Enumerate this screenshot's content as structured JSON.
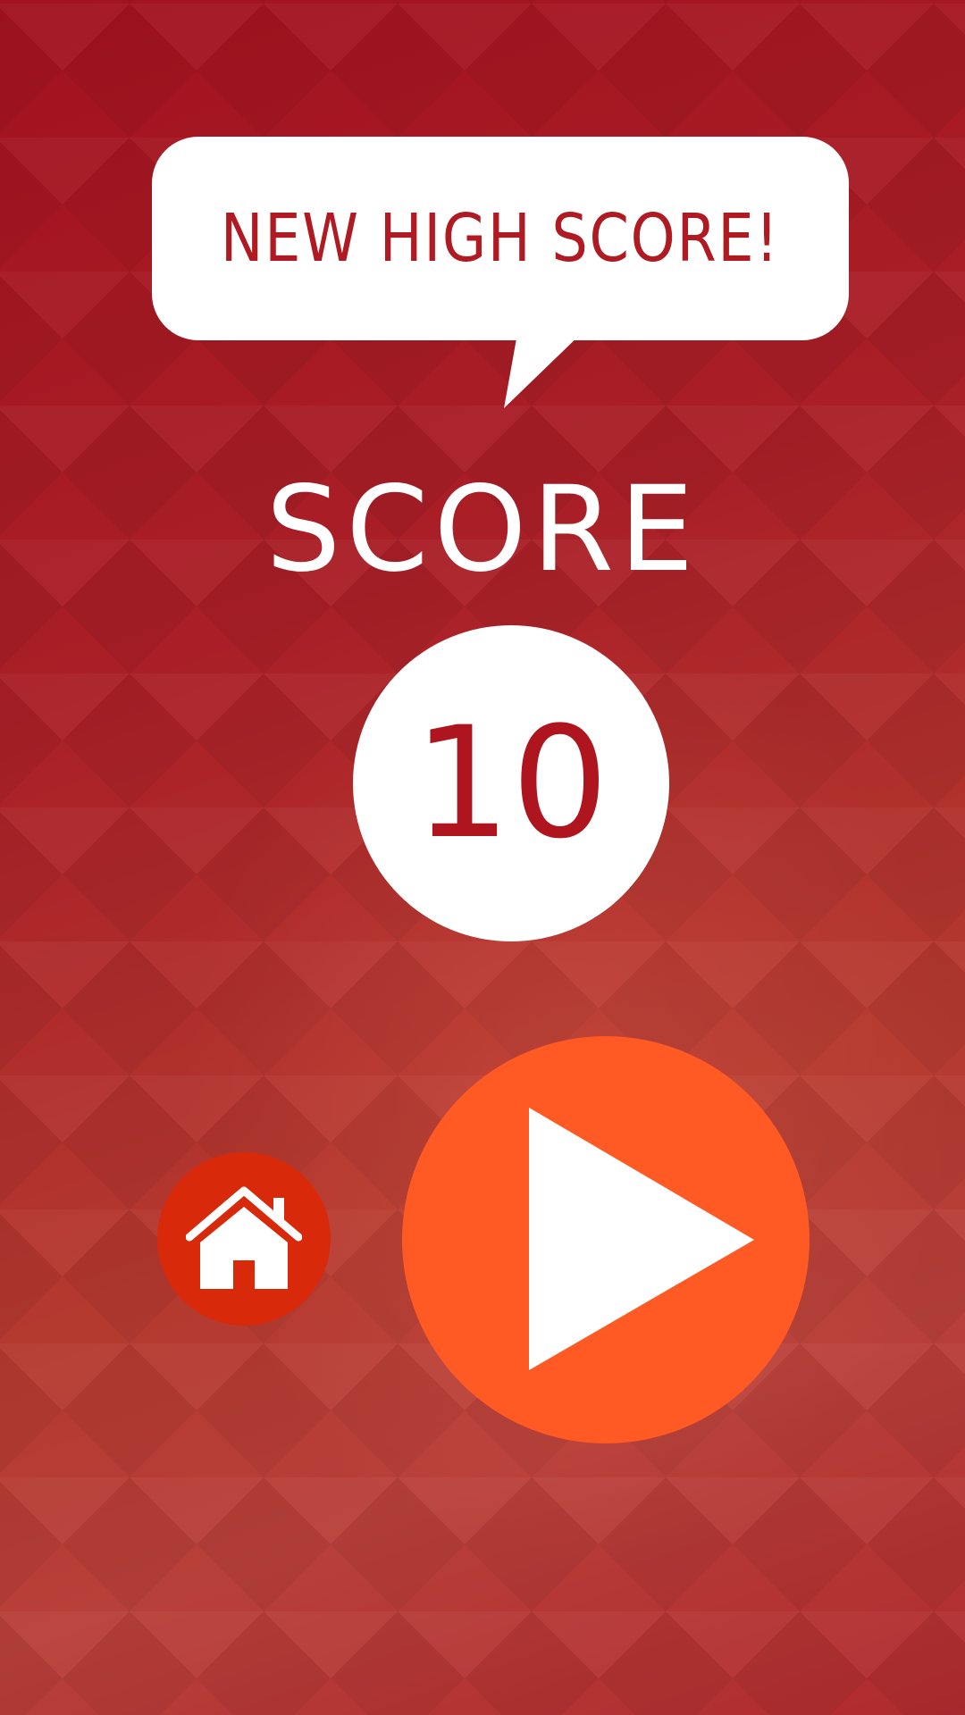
{
  "banner": {
    "text": "NEW HIGH SCORE!"
  },
  "score": {
    "label": "SCORE",
    "value": "10"
  },
  "controls": {
    "home_icon": "home-icon",
    "play_icon": "play-icon"
  },
  "colors": {
    "background": "#a8192a",
    "accent_text": "#b01a22",
    "home_button": "#d9290b",
    "play_button": "#ff5a24",
    "white": "#ffffff"
  }
}
